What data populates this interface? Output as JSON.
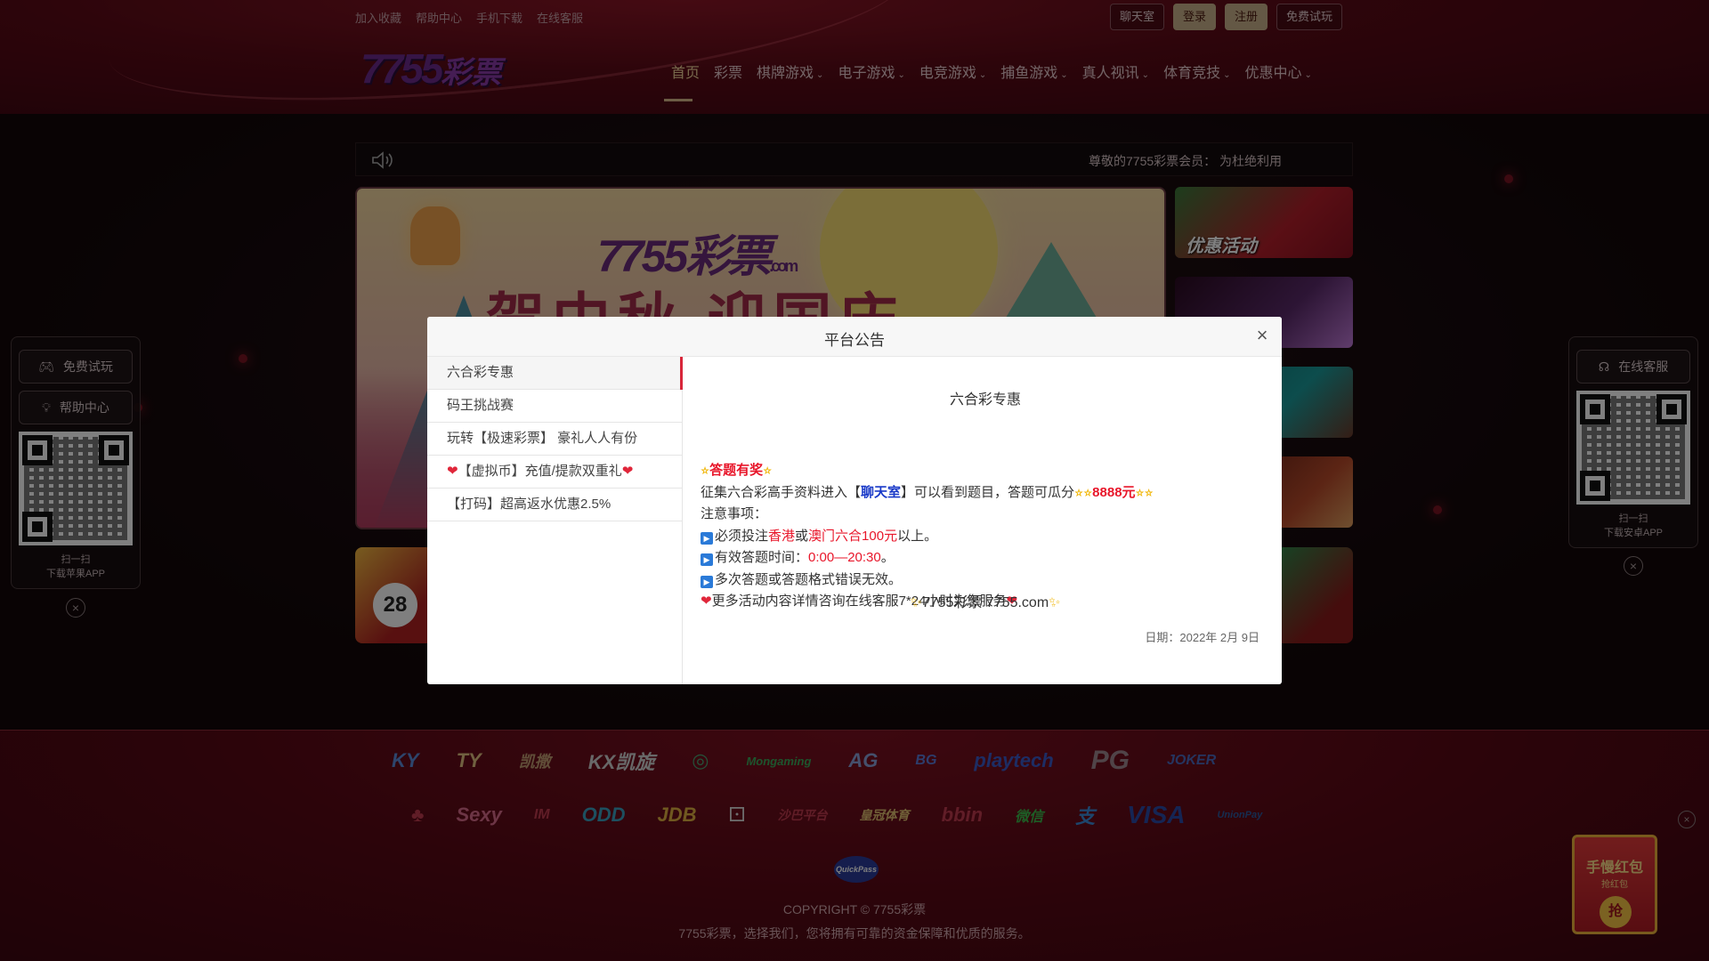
{
  "colors": {
    "brand_red": "#5a0a16",
    "accent_gold": "#d9b98a",
    "modal_active": "#d8263a",
    "highlight_red": "#e8162a",
    "chat_blue": "#1a3ac8"
  },
  "top_links": [
    "加入收藏",
    "帮助中心",
    "手机下载",
    "在线客服"
  ],
  "top_buttons": {
    "chat": "聊天室",
    "login": "登录",
    "register": "注册",
    "trial": "免费试玩"
  },
  "logo": {
    "number": "7755",
    "text": "彩票"
  },
  "nav": [
    "首页",
    "彩票",
    "棋牌游戏",
    "电子游戏",
    "电竞游戏",
    "捕鱼游戏",
    "真人视讯",
    "体育竞技",
    "优惠中心"
  ],
  "marquee": {
    "text": "尊敬的7755彩票会员：  为杜绝利用",
    "icon": "speaker-icon"
  },
  "banner": {
    "logo_number": "7755",
    "logo_text": "彩票",
    "logo_domain": ".com",
    "title": "贺中秋 迎国庆"
  },
  "side_cards": {
    "promo_label": "优惠活动"
  },
  "lower_cards": {
    "left_number": "28"
  },
  "left_panel": {
    "trial_button": "免费试玩",
    "help_button": "帮助中心",
    "scan": "扫一扫",
    "download": "下载苹果APP"
  },
  "right_panel": {
    "service_button": "在线客服",
    "scan": "扫一扫",
    "download": "下载安卓APP"
  },
  "partners_row1": [
    "KY",
    "TY",
    "凯撒",
    "KX凯旋",
    "◎",
    "Mongaming",
    "AG",
    "BG",
    "playtech",
    "PG",
    "JOKER"
  ],
  "partners_row2": [
    "♣",
    "Sexy",
    "IM",
    "ODD",
    "JDB",
    "⚀",
    "沙巴平台",
    "皇冠体育",
    "bbin",
    "微信",
    "支",
    "VISA",
    "UnionPay"
  ],
  "quickpass": "QuickPass",
  "copyright": "COPYRIGHT © 7755彩票",
  "tagline": "7755彩票，选择我们，您将拥有可靠的资金保障和优质的服务。",
  "red_packet": {
    "title": "手慢红包",
    "sub": "抢红包",
    "coin": "抢"
  },
  "modal": {
    "title": "平台公告",
    "tabs": [
      "六合彩专惠",
      "码王挑战赛",
      "玩转【极速彩票】 豪礼人人有份",
      "【虚拟币】充值/提款双重礼",
      "【打码】超高返水优惠2.5%"
    ],
    "content": {
      "title": "六合彩专惠",
      "headline": "答题有奖",
      "line1_a": "征集六合彩高手资料进入【",
      "line1_chat": "聊天室",
      "line1_b": "】可以看到题目，答题可瓜分",
      "line1_amount": "8888元",
      "notes_label": "注意事项：",
      "note1_a": "必须投注",
      "note1_hk": "香港",
      "note1_or": "或",
      "note1_mo": "澳门六合100元",
      "note1_b": "以上。",
      "note2_a": "有效答题时间：",
      "note2_time": "0:00—20:30",
      "note2_b": "。",
      "note3": "多次答题或答题格式错误无效。",
      "note4": "更多活动内容详情咨询在线客服7*24小时为您服务",
      "sign": "7755彩票 7755.com",
      "date": "日期：2022年 2月 9日"
    }
  }
}
